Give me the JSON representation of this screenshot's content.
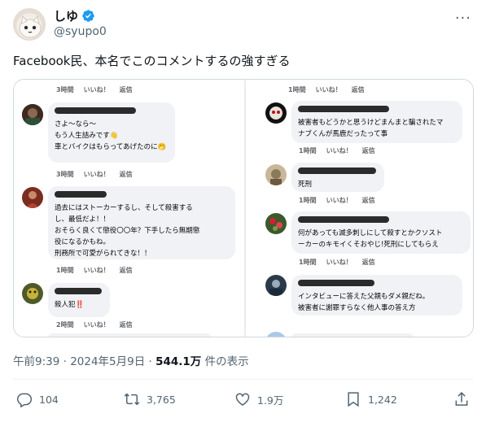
{
  "author": {
    "name": "しゆ",
    "handle": "@syupo0"
  },
  "tweet": {
    "text": "Facebook民、本名でこのコメントするの強すぎる"
  },
  "meta": {
    "time": "午前9:39 · 2024年5月9日 · ",
    "views": "544.1万",
    "views_suffix": " 件の表示"
  },
  "actions": {
    "reply_count": "104",
    "retweet_count": "3,765",
    "like_count": "1.9万",
    "bookmark_count": "1,242"
  },
  "screenshot": {
    "left": {
      "top_meta": {
        "time": "3時間",
        "like": "いいね！",
        "reply": "返信"
      },
      "comments": [
        {
          "text": "さよ～なら～\nもう人生詰みです👋\n車とバイクはもらってあげたのに🤭",
          "time": "3時間",
          "like": "いいね！",
          "reply": "返信"
        },
        {
          "text": "過去にはストーカーするし、そして殺害する\nし、最低だよ！！\nおそらく良くて懲役〇〇年？下手したら無期懲\n役になるかもね。\n刑務所で可愛がられてきな！！",
          "time": "1時間",
          "like": "いいね！",
          "reply": "返信"
        },
        {
          "text": "殺人犯‼️",
          "time": "2時間",
          "like": "いいね！",
          "reply": "返信"
        }
      ]
    },
    "right": {
      "top_meta": {
        "time": "1時間",
        "like": "いいね！",
        "reply": "返信"
      },
      "comments": [
        {
          "text": "被害者もどうかと思うけどまんまと騙されたマ\nナブくんが馬鹿だったって事",
          "time": "1時間",
          "like": "いいね！",
          "reply": "返信"
        },
        {
          "text": "死刑",
          "time": "1時間",
          "like": "いいね！",
          "reply": "返信"
        },
        {
          "text": "何があっても滅多刺しにして殺すとかクソスト\nーカーのキモイくそおやじ!死刑にしてもらえ",
          "time": "1時間",
          "like": "いいね！",
          "reply": "返信"
        },
        {
          "text": "インタビューに答えた父親もダメ親だね。\n被害者に謝罪すらなく他人事の答え方",
          "time": "",
          "like": "",
          "reply": ""
        }
      ]
    }
  }
}
